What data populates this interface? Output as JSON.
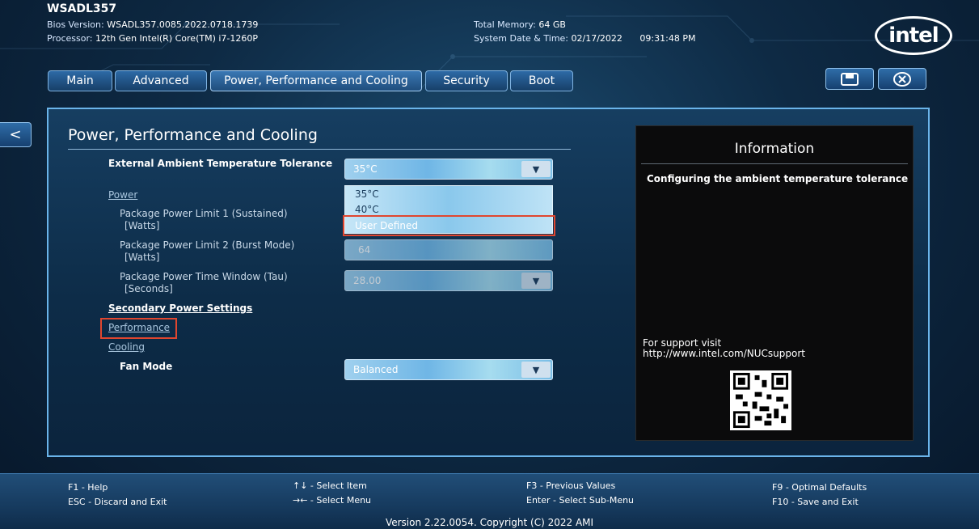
{
  "header": {
    "model": "WSADL357",
    "bios_label": "Bios Version:",
    "bios_value": "WSADL357.0085.2022.0718.1739",
    "processor_label": "Processor:",
    "processor_value": "12th Gen Intel(R) Core(TM) i7-1260P",
    "memory_label": "Total Memory:",
    "memory_value": "64 GB",
    "datetime_label": "System Date & Time:",
    "date_value": "02/17/2022",
    "time_value": "09:31:48 PM",
    "logo_text": "intel"
  },
  "tabs": [
    {
      "label": "Main"
    },
    {
      "label": "Advanced"
    },
    {
      "label": "Power, Performance and Cooling"
    },
    {
      "label": "Security"
    },
    {
      "label": "Boot"
    }
  ],
  "toolbar": {
    "save_icon": "save-icon",
    "exit_icon": "close-circle-icon",
    "back_label": "<"
  },
  "page": {
    "title": "Power, Performance and Cooling",
    "ambient_label": "External Ambient Temperature Tolerance",
    "ambient_value": "35°C",
    "ambient_options": [
      "35°C",
      "40°C",
      "User Defined"
    ],
    "power_link": "Power",
    "ppl1_label": "Package Power Limit 1 (Sustained)",
    "ppl1_unit": "[Watts]",
    "ppl2_label": "Package Power Limit 2 (Burst Mode)",
    "ppl2_unit": "[Watts]",
    "ppl2_value": "64",
    "tau_label": "Package Power Time Window (Tau)",
    "tau_unit": "[Seconds]",
    "tau_value": "28.00",
    "secondary_link": "Secondary Power Settings",
    "performance_link": "Performance",
    "cooling_link": "Cooling",
    "fan_label": "Fan Mode",
    "fan_value": "Balanced"
  },
  "info": {
    "title": "Information",
    "description": "Configuring the ambient temperature tolerance",
    "support_line1": "For support visit",
    "support_line2": "http://www.intel.com/NUCsupport"
  },
  "footer": {
    "f1": "F1 - Help",
    "esc": "ESC - Discard and Exit",
    "select_item": "↑↓ - Select Item",
    "select_menu": "→← - Select Menu",
    "f3": "F3 - Previous Values",
    "enter": "Enter - Select Sub-Menu",
    "f9": "F9 - Optimal Defaults",
    "f10": "F10 - Save and Exit",
    "version": "Version 2.22.0054. Copyright (C) 2022 AMI"
  },
  "colors": {
    "highlight_box": "#e0462f",
    "panel_border": "#6ab4ea",
    "background": "#0e2a44"
  }
}
